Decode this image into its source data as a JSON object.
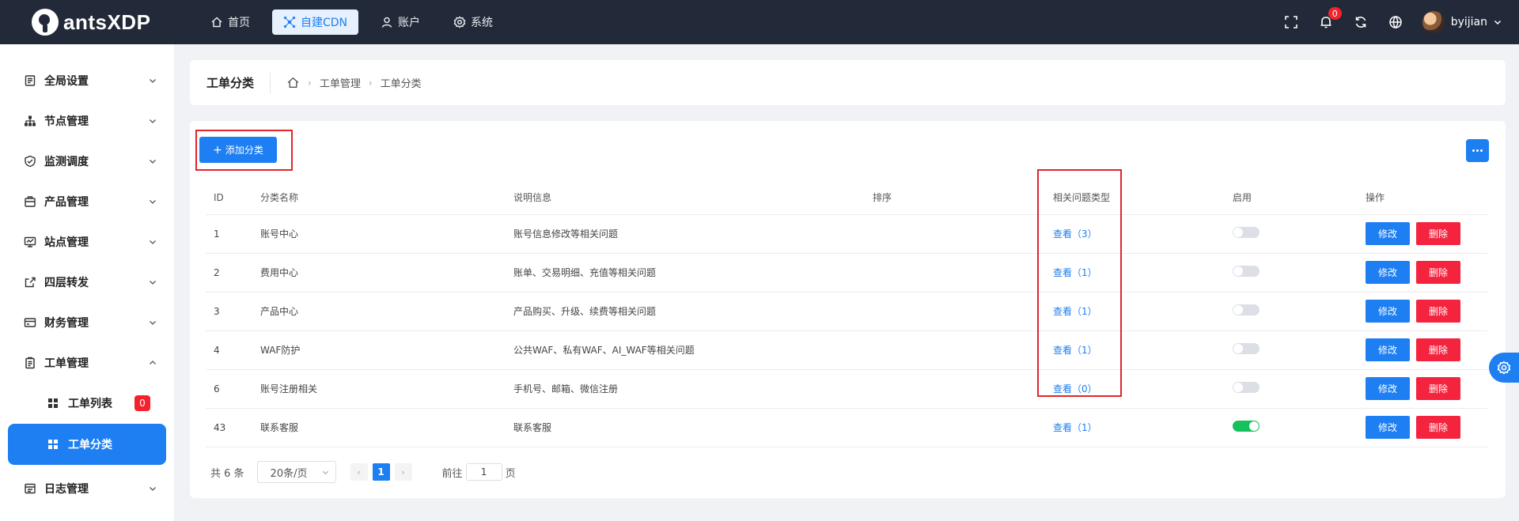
{
  "brand": {
    "name": "antsXDP"
  },
  "topnav": [
    {
      "label": "首页",
      "icon": "home-icon"
    },
    {
      "label": "自建CDN",
      "icon": "network-icon",
      "active": true
    },
    {
      "label": "账户",
      "icon": "user-icon"
    },
    {
      "label": "系统",
      "icon": "gear-icon"
    }
  ],
  "topright": {
    "notification_count": "0",
    "username": "byijian"
  },
  "sidebar": {
    "items": [
      {
        "label": "全局设置"
      },
      {
        "label": "节点管理"
      },
      {
        "label": "监测调度"
      },
      {
        "label": "产品管理"
      },
      {
        "label": "站点管理"
      },
      {
        "label": "四层转发"
      },
      {
        "label": "财务管理"
      },
      {
        "label": "工单管理"
      }
    ],
    "sub": [
      {
        "label": "工单列表",
        "badge": "0"
      },
      {
        "label": "工单分类",
        "active": true
      }
    ],
    "last": {
      "label": "日志管理"
    }
  },
  "header": {
    "title": "工单分类",
    "breadcrumb": [
      "工单管理",
      "工单分类"
    ]
  },
  "toolbar": {
    "add_label": "添加分类"
  },
  "table": {
    "columns": [
      "ID",
      "分类名称",
      "说明信息",
      "排序",
      "相关问题类型",
      "启用",
      "操作"
    ],
    "rows": [
      {
        "id": "1",
        "name": "账号中心",
        "desc": "账号信息修改等相关问题",
        "sort": "",
        "link": "查看（3）",
        "enabled": false
      },
      {
        "id": "2",
        "name": "费用中心",
        "desc": "账单、交易明细、充值等相关问题",
        "sort": "",
        "link": "查看（1）",
        "enabled": false
      },
      {
        "id": "3",
        "name": "产品中心",
        "desc": "产品购买、升级、续费等相关问题",
        "sort": "",
        "link": "查看（1）",
        "enabled": false
      },
      {
        "id": "4",
        "name": "WAF防护",
        "desc": "公共WAF、私有WAF、AI_WAF等相关问题",
        "sort": "",
        "link": "查看（1）",
        "enabled": false
      },
      {
        "id": "6",
        "name": "账号注册相关",
        "desc": "手机号、邮箱、微信注册",
        "sort": "",
        "link": "查看（0）",
        "enabled": false
      },
      {
        "id": "43",
        "name": "联系客服",
        "desc": "联系客服",
        "sort": "",
        "link": "查看（1）",
        "enabled": true
      }
    ],
    "edit_label": "修改",
    "delete_label": "删除"
  },
  "pagination": {
    "total": "共 6 条",
    "page_size": "20条/页",
    "current": "1",
    "goto_prefix": "前往",
    "goto_value": "1",
    "goto_suffix": "页"
  },
  "colors": {
    "primary": "#1e7ff2",
    "danger": "#f4243f",
    "topbar": "#222a39",
    "switch_on": "#16c05a"
  }
}
